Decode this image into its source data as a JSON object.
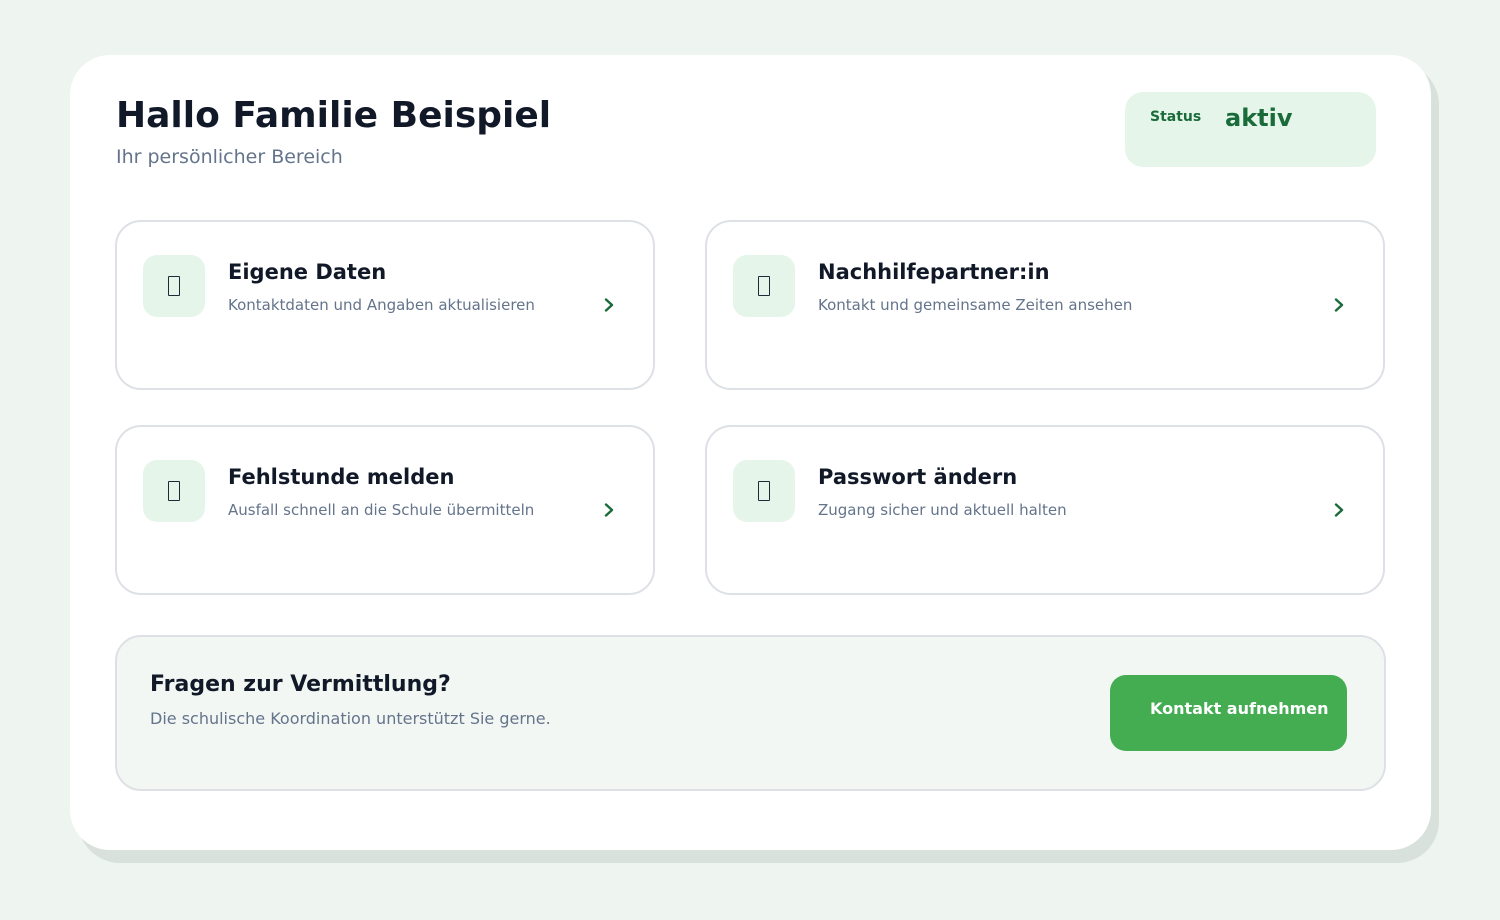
{
  "header": {
    "title": "Hallo Familie Beispiel",
    "subtitle": "Ihr persönlicher Bereich"
  },
  "status": {
    "label": "Status",
    "value": "aktiv"
  },
  "tiles": [
    {
      "title": "Eigene Daten",
      "description": "Kontaktdaten und Angaben aktualisieren",
      "icon": "document-icon"
    },
    {
      "title": "Nachhilfepartner:in",
      "description": "Kontakt und gemeinsame Zeiten ansehen",
      "icon": "document-icon"
    },
    {
      "title": "Fehlstunde melden",
      "description": "Ausfall schnell an die Schule übermitteln",
      "icon": "document-icon"
    },
    {
      "title": "Passwort ändern",
      "description": "Zugang sicher und aktuell halten",
      "icon": "document-icon"
    }
  ],
  "help": {
    "title": "Fragen zur Vermittlung?",
    "description": "Die schulische Koordination unterstützt Sie gerne.",
    "button_label": "Kontakt aufnehmen"
  },
  "colors": {
    "accent": "#44ad52",
    "accent_dark": "#1a6b3a",
    "accent_light": "#e6f5ea"
  }
}
